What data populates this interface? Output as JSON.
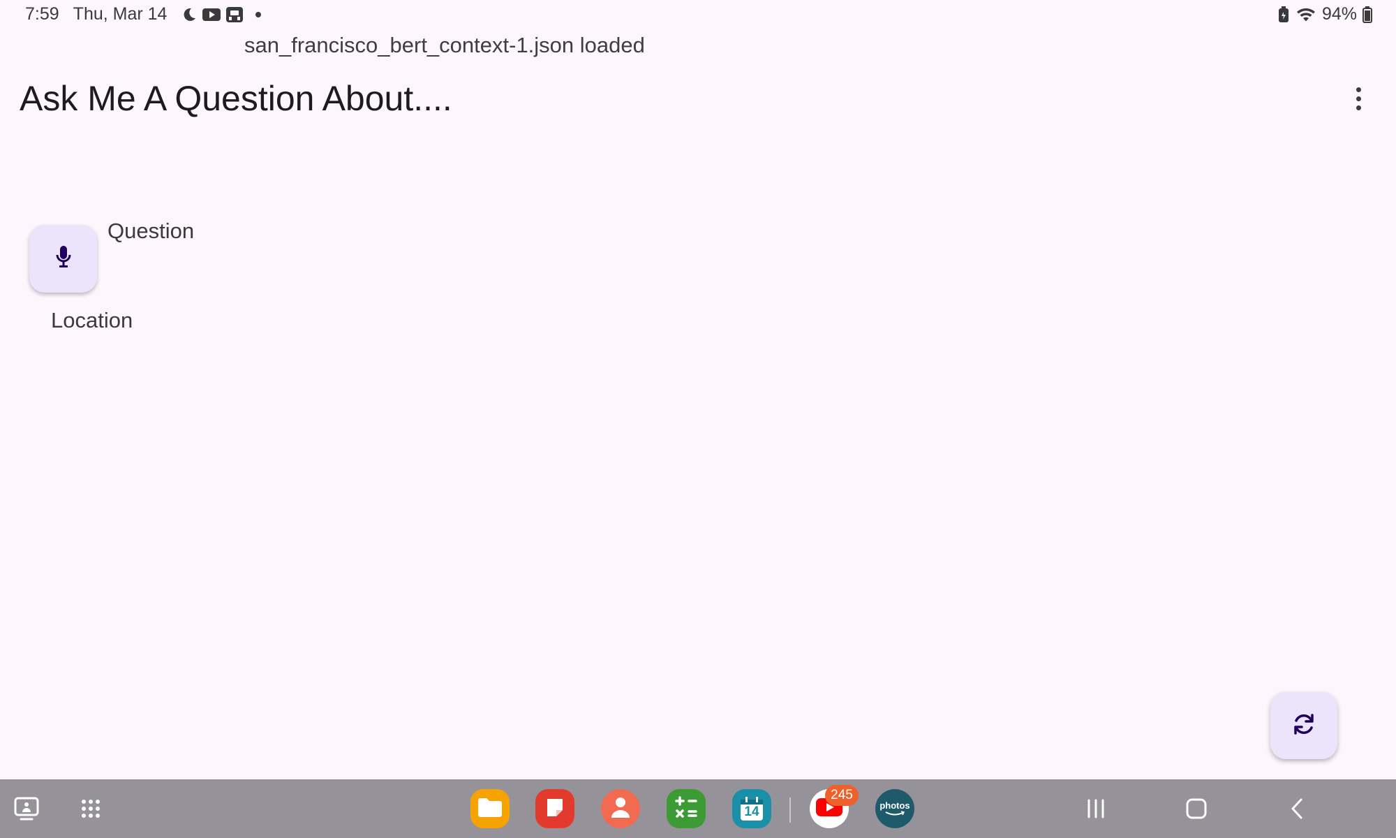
{
  "status_bar": {
    "time": "7:59",
    "date": "Thu, Mar 14",
    "battery": "94%",
    "icons_left": [
      "moon-icon",
      "youtube-notification-icon",
      "app-notification-icon",
      "more-dot-icon"
    ],
    "icons_right": [
      "battery-saver-icon",
      "wifi-icon",
      "battery-icon"
    ]
  },
  "toast": {
    "message": "san_francisco_bert_context-1.json loaded"
  },
  "app_bar": {
    "title": "Ask Me A Question About....",
    "menu_icon": "more-vert-icon"
  },
  "main": {
    "mic_icon": "mic-icon",
    "question_label": "Question",
    "location_label": "Location",
    "refresh_icon": "refresh-icon"
  },
  "taskbar": {
    "left_icons": [
      "recent-apps-panel-icon",
      "app-drawer-icon"
    ],
    "apps": [
      {
        "name": "My Files",
        "icon": "folder-icon",
        "color": "#f4a300"
      },
      {
        "name": "Notes",
        "icon": "note-icon",
        "color": "#e33a2e"
      },
      {
        "name": "Contacts",
        "icon": "person-icon",
        "color": "#f26a4f"
      },
      {
        "name": "Calculator",
        "icon": "calculator-icon",
        "color": "#3d9b35"
      },
      {
        "name": "Calendar",
        "icon": "calendar-icon",
        "color": "#1a8fa8",
        "day": "14"
      },
      {
        "name": "YouTube",
        "icon": "youtube-icon",
        "color": "#ffffff",
        "badge": "245"
      },
      {
        "name": "Amazon Photos",
        "icon": "photos-icon",
        "color": "#1f5a6a",
        "label": "photos"
      }
    ],
    "nav_icons": [
      "recents-icon",
      "home-icon",
      "back-icon"
    ]
  },
  "colors": {
    "background": "#fdf7fd",
    "fab_container": "#ece4fa",
    "taskbar": "#959299",
    "on_container": "#21005d"
  }
}
